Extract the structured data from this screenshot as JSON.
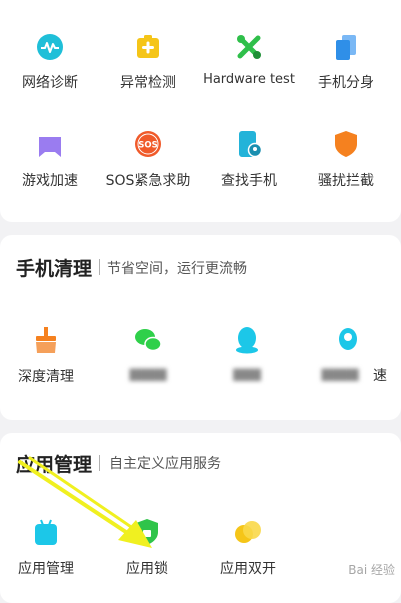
{
  "tools": {
    "items": [
      {
        "label": "网络诊断",
        "icon": "network-diagnose-icon",
        "color": "#1fbfd8"
      },
      {
        "label": "异常检测",
        "icon": "anomaly-check-icon",
        "color": "#f5c518"
      },
      {
        "label": "Hardware test",
        "icon": "hardware-test-icon",
        "color": "#2fbf4a"
      },
      {
        "label": "手机分身",
        "icon": "phone-clone-icon",
        "color": "#2f8fe8"
      },
      {
        "label": "游戏加速",
        "icon": "game-boost-icon",
        "color": "#9a7cf0"
      },
      {
        "label": "SOS紧急求助",
        "icon": "sos-icon",
        "color": "#f05a2a"
      },
      {
        "label": "查找手机",
        "icon": "find-phone-icon",
        "color": "#23b3d9"
      },
      {
        "label": "骚扰拦截",
        "icon": "harassment-block-icon",
        "color": "#f5811f"
      }
    ]
  },
  "cleanup": {
    "title": "手机清理",
    "subtitle": "节省空间，运行更流畅",
    "items": [
      {
        "label": "深度清理",
        "icon": "deep-clean-icon",
        "color": "#f5811f"
      },
      {
        "label": "",
        "icon": "wechat-clean-icon",
        "color": "#2fd04a"
      },
      {
        "label": "",
        "icon": "qq-clean-icon",
        "color": "#1cc7e8"
      },
      {
        "label": "速",
        "icon": "qq-space-clean-icon",
        "color": "#1cc7e8"
      }
    ]
  },
  "apps": {
    "title": "应用管理",
    "subtitle": "自主定义应用服务",
    "items": [
      {
        "label": "应用管理",
        "icon": "app-manage-icon",
        "color": "#1cc7e8"
      },
      {
        "label": "应用锁",
        "icon": "app-lock-icon",
        "color": "#2fc44a"
      },
      {
        "label": "应用双开",
        "icon": "dual-apps-icon",
        "color": "#f5c518"
      }
    ]
  },
  "watermark": "Bai 经验"
}
